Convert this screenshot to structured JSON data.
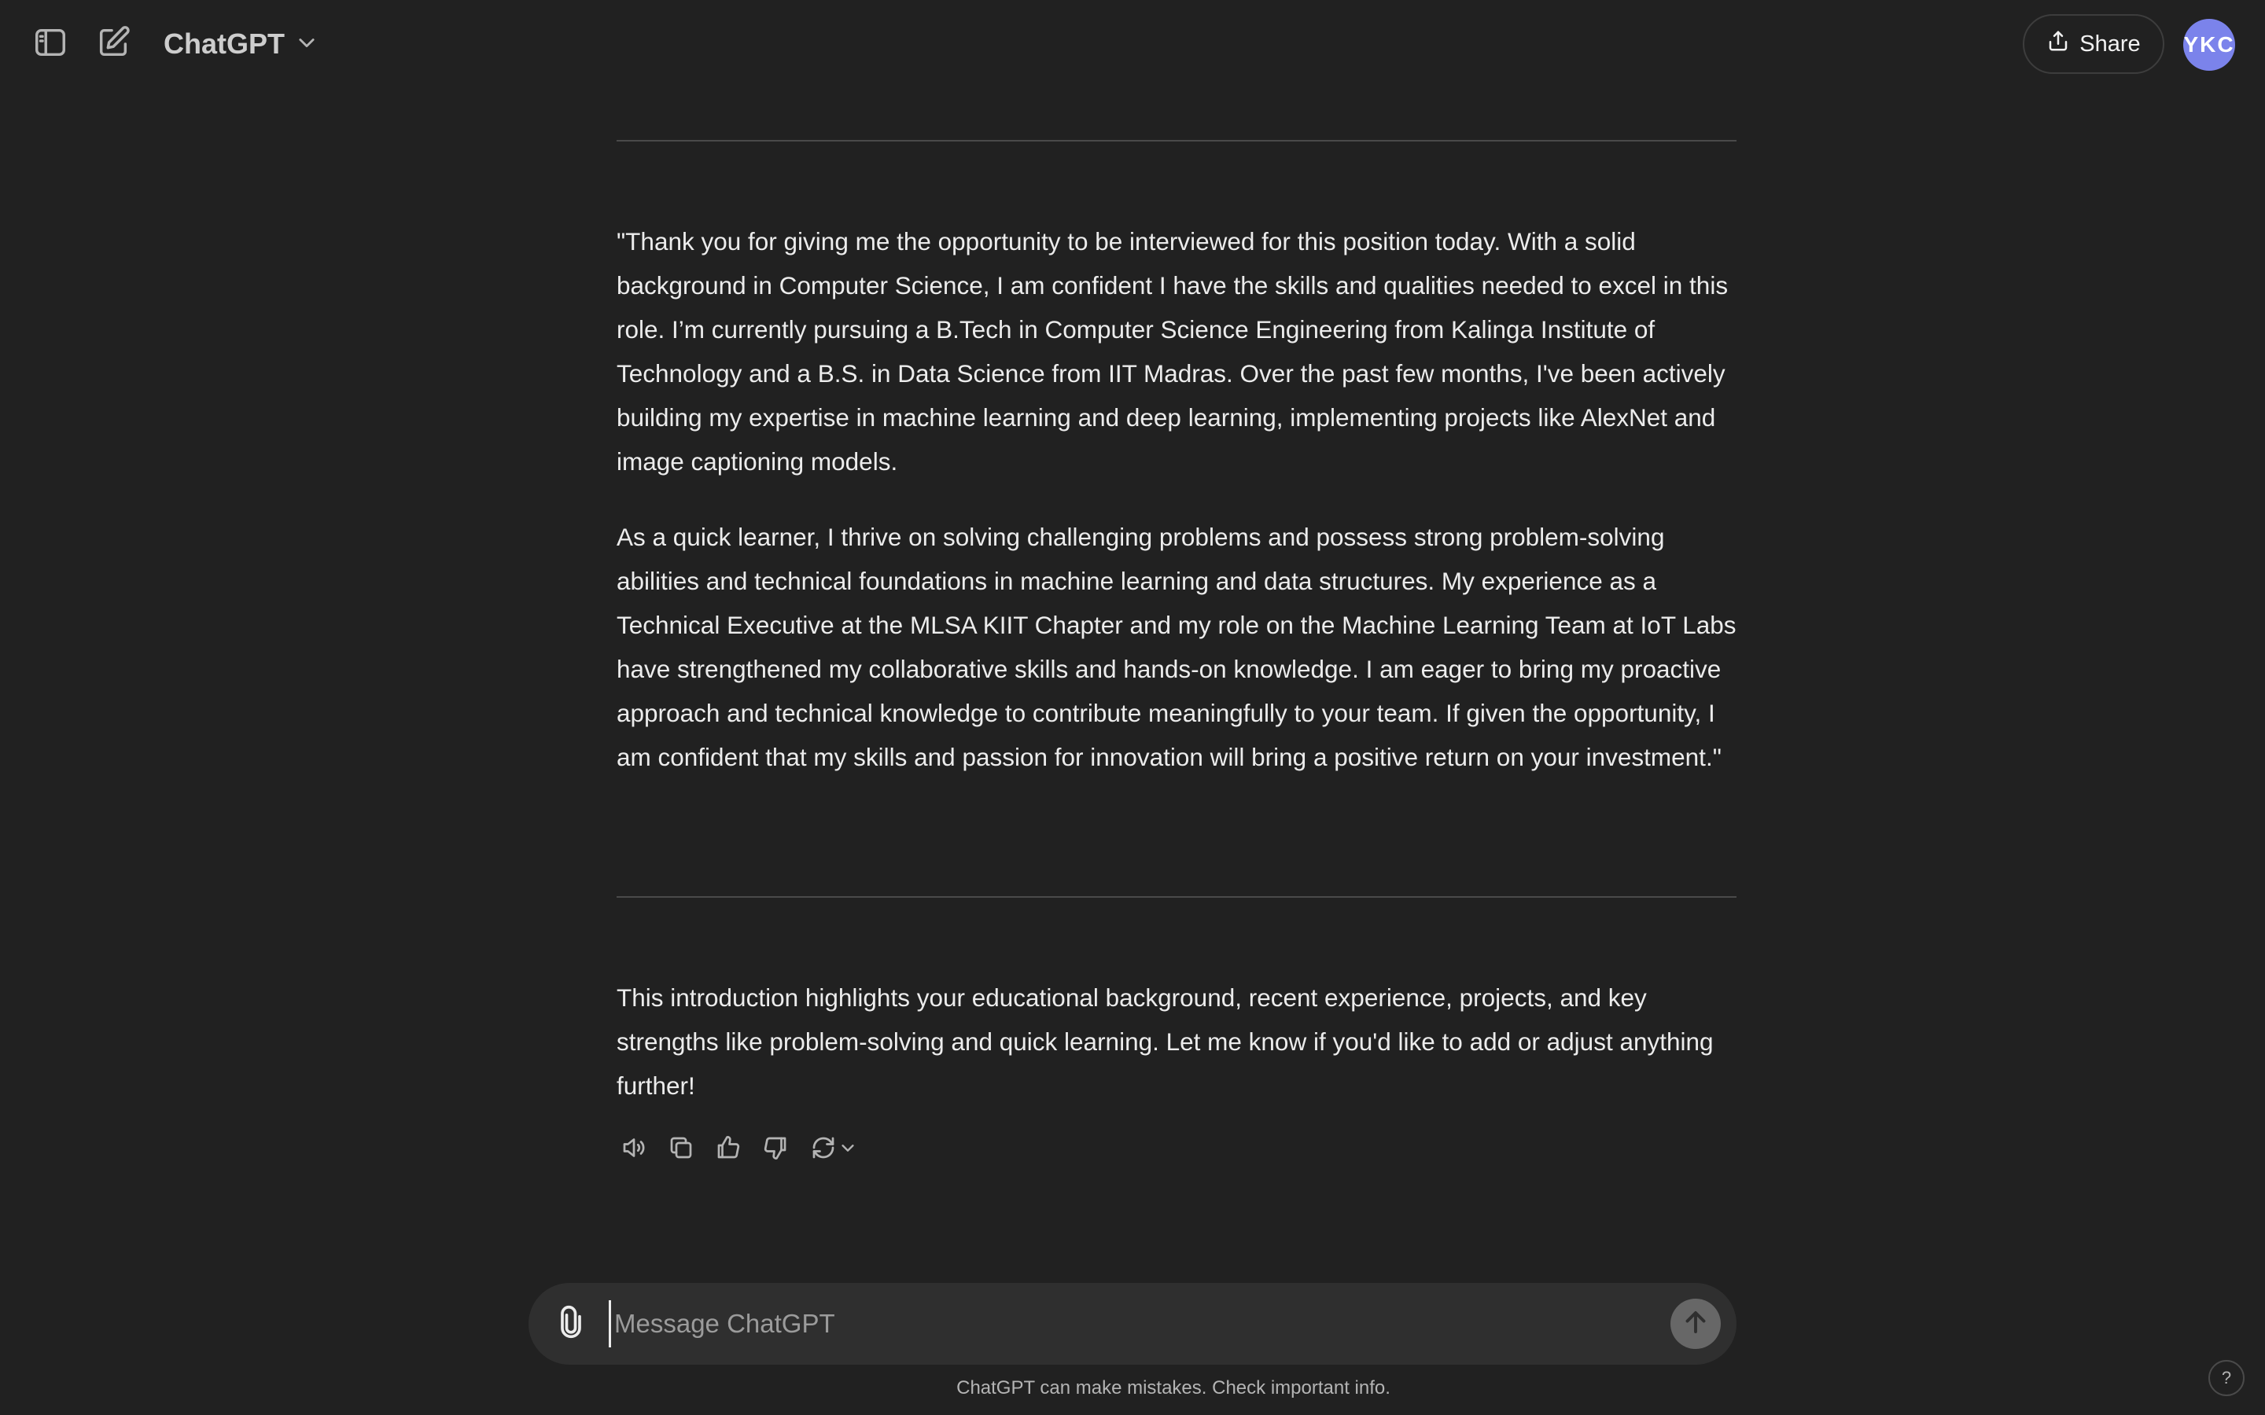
{
  "header": {
    "model_name": "ChatGPT",
    "share_label": "Share",
    "avatar_initials": "YKC",
    "icons": [
      "sidebar-toggle-icon",
      "new-chat-icon",
      "chevron-down-icon",
      "share-icon"
    ]
  },
  "message": {
    "intro_quote_paragraph_1": "\"Thank you for giving me the opportunity to be interviewed for this position today. With a solid background in Computer Science, I am confident I have the skills and qualities needed to excel in this role. I’m currently pursuing a B.Tech in Computer Science Engineering from Kalinga Institute of Technology and a B.S. in Data Science from IIT Madras. Over the past few months, I've been actively building my expertise in machine learning and deep learning, implementing projects like AlexNet and image captioning models.",
    "intro_quote_paragraph_2": "As a quick learner, I thrive on solving challenging problems and possess strong problem-solving abilities and technical foundations in machine learning and data structures. My experience as a Technical Executive at the MLSA KIIT Chapter and my role on the Machine Learning Team at IoT Labs have strengthened my collaborative skills and hands-on knowledge. I am eager to bring my proactive approach and technical knowledge to contribute meaningfully to your team. If given the opportunity, I am confident that my skills and passion for innovation will bring a positive return on your investment.\"",
    "closing_paragraph": "This introduction highlights your educational background, recent experience, projects, and key strengths like problem-solving and quick learning. Let me know if you'd like to add or adjust anything further!",
    "action_icons": [
      "read-aloud-icon",
      "copy-icon",
      "thumbs-up-icon",
      "thumbs-down-icon",
      "regenerate-icon"
    ]
  },
  "composer": {
    "placeholder": "Message ChatGPT",
    "value": ""
  },
  "footer": {
    "disclaimer": "ChatGPT can make mistakes. Check important info.",
    "help_label": "?"
  },
  "colors": {
    "background": "#212121",
    "composer_bg": "#2f2f2f",
    "text": "#ececec",
    "avatar": "#7b83eb"
  }
}
